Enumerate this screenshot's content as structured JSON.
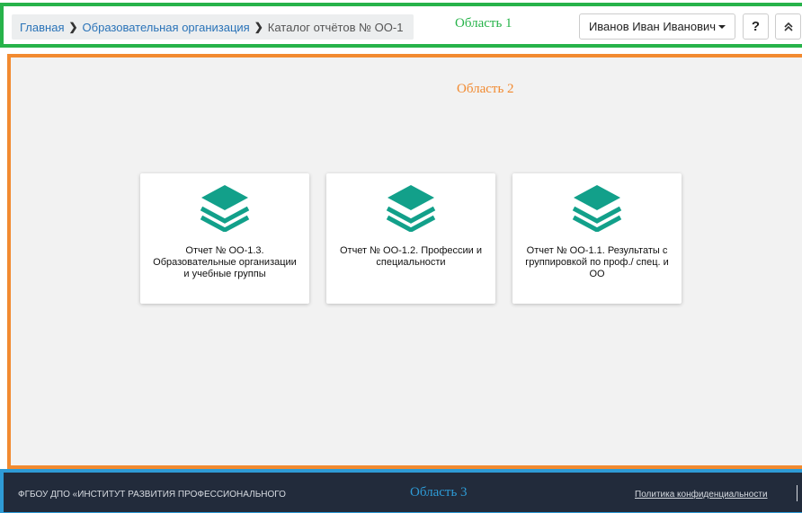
{
  "header": {
    "breadcrumb": {
      "home": "Главная",
      "organization": "Образовательная организация",
      "current": "Каталог отчётов № ОО-1"
    },
    "area_label": "Область 1",
    "user_name": "Иванов Иван Иванович",
    "help_label": "?",
    "collapse_icon": "double-chevron-up-icon"
  },
  "main": {
    "area_label": "Область 2",
    "cards": [
      {
        "title": "Отчет № ОО-1.3. Образовательные организации и учебные группы",
        "icon": "layers-icon"
      },
      {
        "title": "Отчет № ОО-1.2. Профессии и специальности",
        "icon": "layers-icon"
      },
      {
        "title": "Отчет № ОО-1.1. Результаты с группировкой по проф./ спец. и ОО",
        "icon": "layers-icon"
      }
    ]
  },
  "footer": {
    "org": "ФГБОУ ДПО «ИНСТИТУТ РАЗВИТИЯ ПРОФЕССИОНАЛЬНОГО",
    "area_label": "Область 3",
    "privacy_link": "Политика конфиденциальности"
  },
  "colors": {
    "area1_border": "#27b34a",
    "area2_border": "#f28a30",
    "area3_border": "#2e9bd6",
    "icon_teal": "#12a08a",
    "footer_bg": "#222b3b",
    "link": "#2a73b8"
  }
}
